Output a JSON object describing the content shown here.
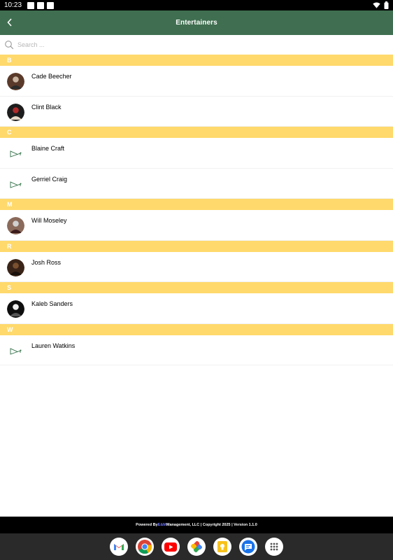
{
  "status_bar": {
    "time": "10:23"
  },
  "header": {
    "title": "Entertainers"
  },
  "search": {
    "placeholder": "Search ..."
  },
  "sections": [
    {
      "letter": "B",
      "items": [
        {
          "name": "Cade Beecher",
          "avatar": "photo"
        },
        {
          "name": "Clint Black",
          "avatar": "photo"
        }
      ]
    },
    {
      "letter": "C",
      "items": [
        {
          "name": "Blaine Craft",
          "avatar": "placeholder"
        },
        {
          "name": "Gerriel Craig",
          "avatar": "placeholder"
        }
      ]
    },
    {
      "letter": "M",
      "items": [
        {
          "name": "Will Moseley",
          "avatar": "photo"
        }
      ]
    },
    {
      "letter": "R",
      "items": [
        {
          "name": "Josh Ross",
          "avatar": "photo"
        }
      ]
    },
    {
      "letter": "S",
      "items": [
        {
          "name": "Kaleb Sanders",
          "avatar": "photo"
        }
      ]
    },
    {
      "letter": "W",
      "items": [
        {
          "name": "Lauren Watkins",
          "avatar": "placeholder"
        }
      ]
    }
  ],
  "footer": {
    "prefix": "Powered By ",
    "brand": "E&M",
    "suffix": " Management, LLC | Copyright 2025 | Version 1.1.0"
  },
  "dock": {
    "apps": [
      "gmail-icon",
      "chrome-icon",
      "youtube-icon",
      "photos-icon",
      "keep-icon",
      "messages-icon",
      "app-drawer-icon"
    ]
  },
  "colors": {
    "header_bg": "#3f6f50",
    "section_bg": "#ffd96c",
    "footer_bg": "#000000",
    "dock_bg": "#2a2a2a"
  }
}
